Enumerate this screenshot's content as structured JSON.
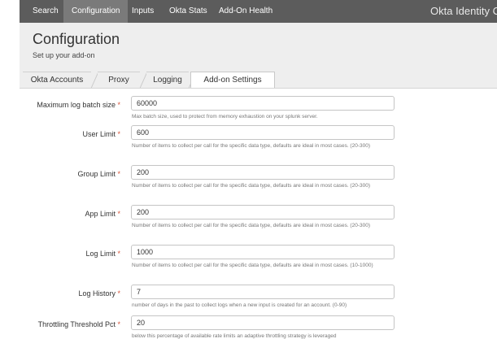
{
  "topnav": {
    "items": [
      "Search",
      "Configuration",
      "Inputs",
      "Okta Stats",
      "Add-On Health"
    ],
    "active_index": 1,
    "app_title": "Okta Identity C"
  },
  "header": {
    "title": "Configuration",
    "subtitle": "Set up your add-on"
  },
  "tabs": {
    "items": [
      "Okta Accounts",
      "Proxy",
      "Logging",
      "Add-on Settings"
    ],
    "active_index": 3
  },
  "required_marker": "*",
  "fields": [
    {
      "label": "Maximum log batch size",
      "value": "60000",
      "help": "Max batch size, used to protect from memory exhaustion on your splunk server."
    },
    {
      "label": "User Limit",
      "value": "600",
      "help": "Number of items to collect per call for the specific data type, defaults are ideal in most cases. (20-300)"
    },
    {
      "label": "Group Limit",
      "value": "200",
      "help": "Number of items to collect per call for the specific data type, defaults are ideal in most cases. (20-300)"
    },
    {
      "label": "App Limit",
      "value": "200",
      "help": "Number of items to collect per call for the specific data type, defaults are ideal in most cases. (20-300)"
    },
    {
      "label": "Log Limit",
      "value": "1000",
      "help": "Number of items to collect per call for the specific data type, defaults are ideal in most cases. (10-1000)"
    },
    {
      "label": "Log History",
      "value": "7",
      "help": "number of days in the past to collect logs when a new input is created for an account. (0-90)"
    },
    {
      "label": "Throttling Threshold Pct",
      "value": "20",
      "help": "below this percentage of available rate limits an adaptive throttling strategy is leveraged"
    }
  ]
}
